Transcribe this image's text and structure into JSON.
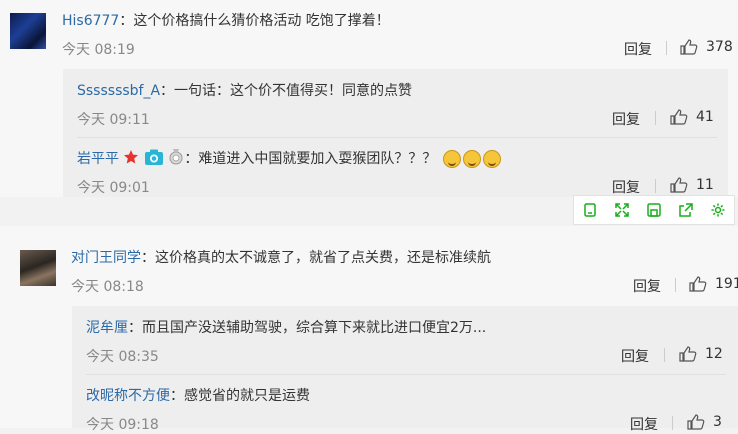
{
  "comments": [
    {
      "user": "His6777",
      "text": "：这个价格搞什么猜价格活动 吃饱了撑着！",
      "time": "今天 08:19",
      "reply_label": "回复",
      "likes": "378",
      "replies": [
        {
          "user": "Sssssssbf_A",
          "text": "：一句话：这个价不值得买！同意的点赞",
          "time": "今天 09:11",
          "reply_label": "回复",
          "likes": "41"
        },
        {
          "user": "岩平平",
          "text": "：难道进入中国就要加入耍猴团队？？？",
          "time": "今天 09:01",
          "reply_label": "回复",
          "likes": "11"
        }
      ]
    },
    {
      "user": "对门王同学",
      "text": "：这价格真的太不诚意了，就省了点关费，还是标准续航",
      "time": "今天 08:18",
      "reply_label": "回复",
      "likes": "191",
      "replies": [
        {
          "user": "泥牟厘",
          "text": "：而且国产没送辅助驾驶，综合算下来就比进口便宜2万...",
          "time": "今天 08:35",
          "reply_label": "回复",
          "likes": "12"
        },
        {
          "user": "改昵称不方便",
          "text": "：感觉省的就只是运费",
          "time": "今天 09:18",
          "reply_label": "回复",
          "likes": "3"
        }
      ]
    }
  ],
  "toolbar": [
    "copy-icon",
    "expand-icon",
    "save-icon",
    "share-icon",
    "settings-icon"
  ],
  "colors": {
    "username": "#2b6aa6",
    "timestamp": "#888888",
    "toolbar_icon": "#1aad19"
  }
}
